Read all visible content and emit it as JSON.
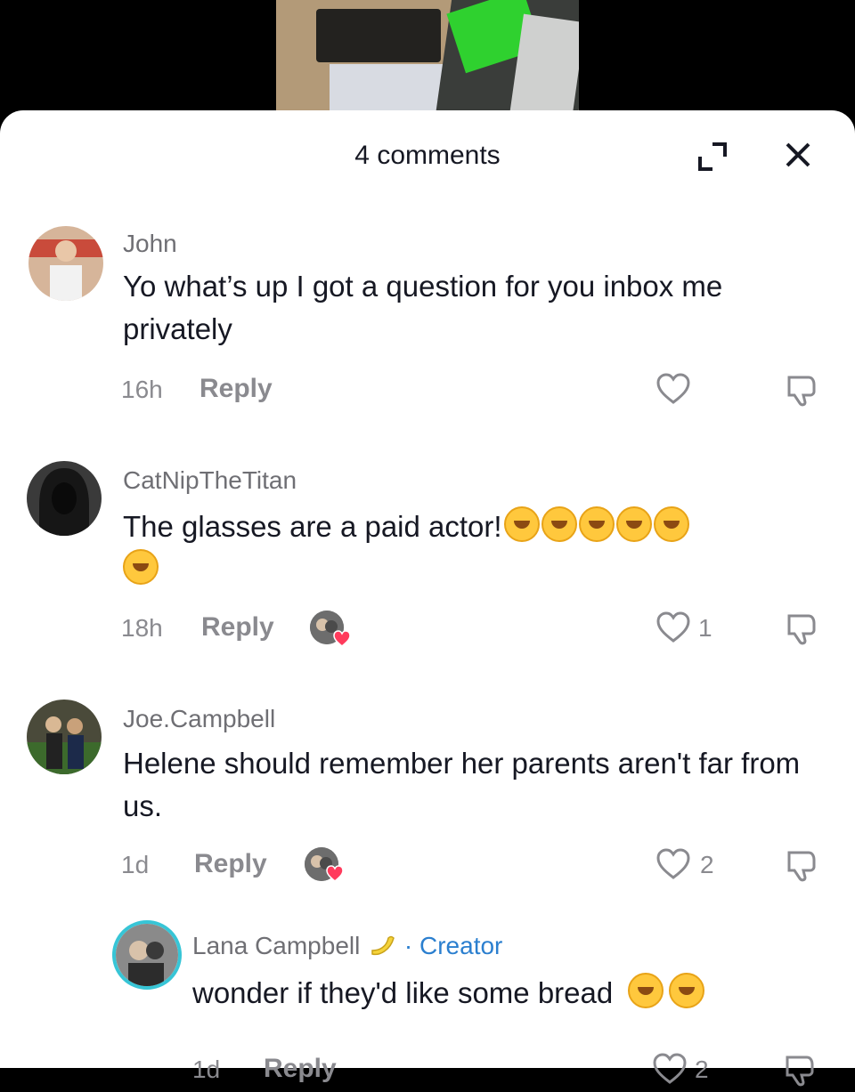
{
  "header": {
    "title": "4 comments"
  },
  "comments": [
    {
      "username": "John",
      "text": "Yo what’s up I got a question for you inbox me privately",
      "time": "16h",
      "reply": "Reply",
      "likes": ""
    },
    {
      "username": "CatNipTheTitan",
      "text": "The glasses are a paid actor!",
      "time": "18h",
      "reply": "Reply",
      "likes": "1"
    },
    {
      "username": "Joe.Campbell",
      "text": "Helene should remember her parents aren't far from us.",
      "time": "1d",
      "reply": "Reply",
      "likes": "2"
    },
    {
      "username": "Lana Campbell",
      "badge": "· Creator",
      "text": "wonder if they'd like some bread",
      "time": "1d",
      "reply": "Reply",
      "likes": "2"
    }
  ],
  "icons": [
    "expand-icon",
    "close-icon",
    "heart-icon",
    "dislike-icon",
    "emoji-icon"
  ],
  "colors": {
    "accent": "#2b7fcf",
    "heart": "#ff3b5c"
  }
}
